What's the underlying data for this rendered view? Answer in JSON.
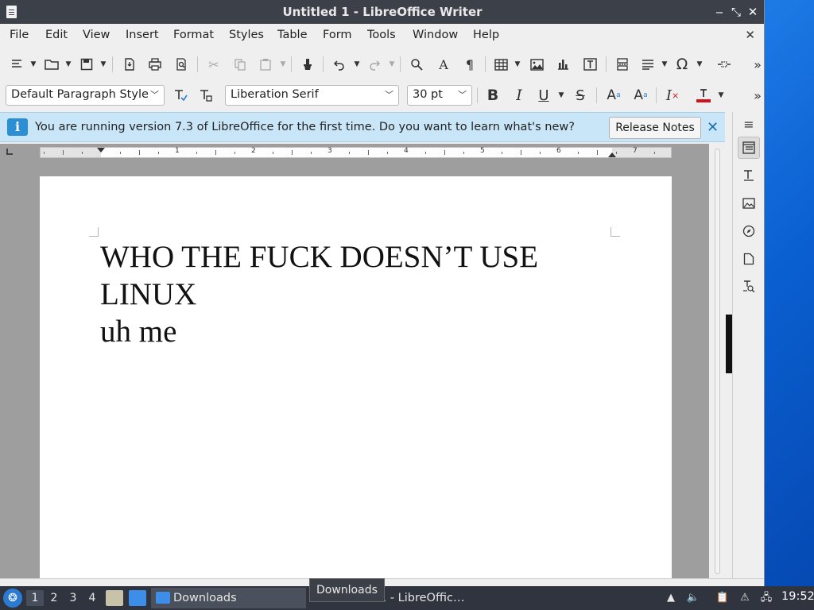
{
  "window": {
    "title": "Untitled 1 - LibreOffice Writer",
    "minimize_glyph": "‒",
    "restore_glyph": "⤡",
    "close_glyph": "✕"
  },
  "menubar": {
    "items": [
      "File",
      "Edit",
      "View",
      "Insert",
      "Format",
      "Styles",
      "Table",
      "Form",
      "Tools",
      "Window",
      "Help"
    ],
    "close_document_glyph": "✕"
  },
  "toolbar_standard": {
    "icons": [
      "new-document-icon",
      "open-icon",
      "save-icon",
      "export-pdf-icon",
      "print-icon",
      "print-preview-icon",
      "cut-icon",
      "copy-icon",
      "paste-icon",
      "clone-formatting-icon",
      "undo-icon",
      "redo-icon",
      "find-replace-icon",
      "spelling-icon",
      "formatting-marks-icon",
      "insert-table-icon",
      "insert-image-icon",
      "insert-chart-icon",
      "insert-textbox-icon",
      "insert-page-break-icon",
      "insert-field-icon",
      "special-character-icon",
      "insert-comment-icon",
      "more-icon"
    ]
  },
  "toolbar_formatting": {
    "paragraph_style": "Default Paragraph Style",
    "font_name": "Liberation Serif",
    "font_size": "30 pt",
    "icons": [
      "update-style-icon",
      "new-style-icon",
      "bold-icon",
      "italic-icon",
      "underline-icon",
      "strikethrough-icon",
      "superscript-icon",
      "subscript-icon",
      "clear-formatting-icon",
      "font-color-icon",
      "more-icon"
    ],
    "font_color": "#d0131a"
  },
  "infobar": {
    "message": "You are running version 7.3 of LibreOffice for the first time. Do you want to learn what's new?",
    "button_label": "Release Notes",
    "background": "#c8e6f7"
  },
  "ruler": {
    "numbers": [
      "1",
      "2",
      "3",
      "4",
      "5",
      "6",
      "7"
    ]
  },
  "document": {
    "lines": [
      "WHO THE FUCK DOESN’T USE",
      "LINUX",
      "uh me"
    ]
  },
  "sidebar": {
    "icons": [
      "sidebar-menu-icon",
      "properties-icon",
      "styles-icon",
      "gallery-icon",
      "navigator-icon",
      "page-icon",
      "style-inspector-icon"
    ]
  },
  "taskbar": {
    "workspaces": [
      "1",
      "2",
      "3",
      "4"
    ],
    "tasks": [
      {
        "label": "Downloads"
      },
      {
        "label": "1 - LibreOffic…"
      }
    ],
    "tooltip": "Downloads",
    "clock": "19:52",
    "accent": "#2b7bd2"
  }
}
